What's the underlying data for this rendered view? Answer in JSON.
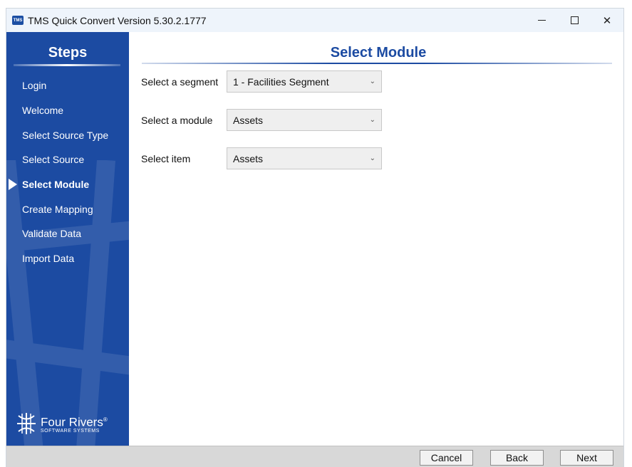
{
  "window": {
    "icon_text": "TMS",
    "title": "TMS Quick Convert Version 5.30.2.1777"
  },
  "sidebar": {
    "title": "Steps",
    "items": [
      {
        "label": "Login"
      },
      {
        "label": "Welcome"
      },
      {
        "label": "Select Source Type"
      },
      {
        "label": "Select Source"
      },
      {
        "label": "Select Module",
        "active": true
      },
      {
        "label": "Create Mapping"
      },
      {
        "label": "Validate Data"
      },
      {
        "label": "Import Data"
      }
    ],
    "logo": {
      "name": "Four Rivers",
      "mark": "®",
      "subtitle": "SOFTWARE SYSTEMS"
    }
  },
  "main": {
    "title": "Select Module",
    "fields": [
      {
        "label": "Select a segment",
        "value": "1 - Facilities Segment"
      },
      {
        "label": "Select a module",
        "value": "Assets"
      },
      {
        "label": "Select item",
        "value": "Assets"
      }
    ]
  },
  "footer": {
    "cancel": "Cancel",
    "back": "Back",
    "next": "Next"
  },
  "colors": {
    "sidebar": "#1c4ba2",
    "title": "#1c4ba2",
    "footer": "#d8d8d8"
  },
  "icons": {
    "minimize": "minimize-icon",
    "maximize": "maximize-icon",
    "close": "close-icon",
    "dropdown": "chevron-down-icon",
    "step_pointer": "arrow-right-icon",
    "logo": "four-rivers-logo-icon"
  }
}
